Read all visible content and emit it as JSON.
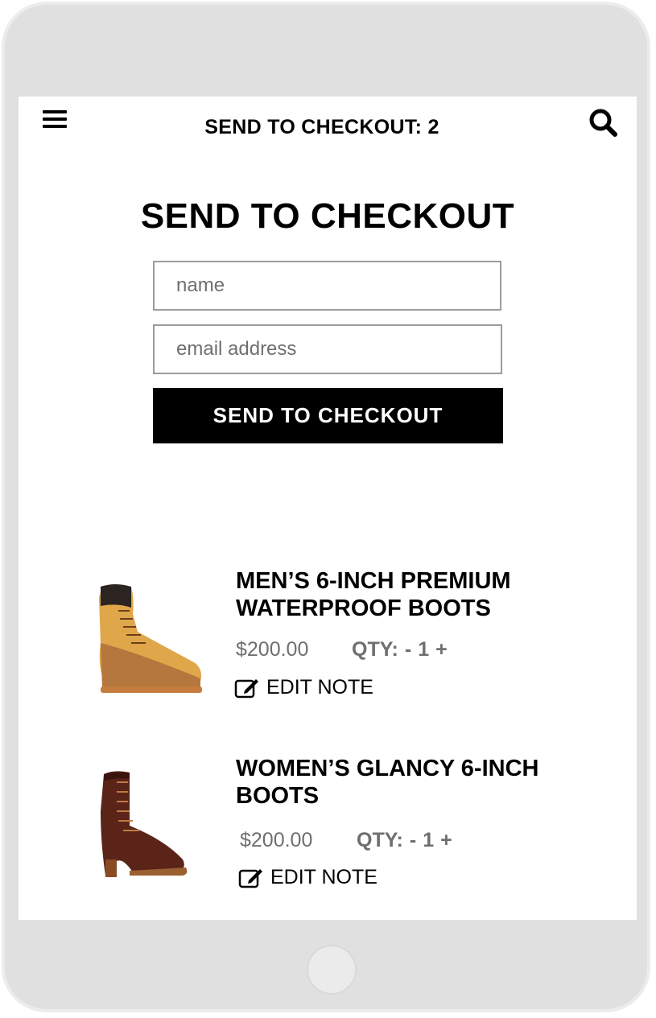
{
  "header": {
    "title": "SEND TO CHECKOUT: 2",
    "menu_icon": "hamburger-menu-icon",
    "search_icon": "search-icon"
  },
  "form": {
    "heading": "SEND TO CHECKOUT",
    "name_placeholder": "name",
    "email_placeholder": "email address",
    "submit_label": "SEND TO CHECKOUT"
  },
  "items": [
    {
      "title": "MEN’S 6-INCH PREMIUM WATERPROOF BOOTS",
      "price": "$200.00",
      "qty_label": "QTY:",
      "qty_minus": "-",
      "qty_value": "1",
      "qty_plus": "+",
      "edit_note_label": "EDIT NOTE",
      "image": "wheat-nubuck-work-boot-image"
    },
    {
      "title": "WOMEN’S GLANCY 6-INCH BOOTS",
      "price": "$200.00",
      "qty_label": "QTY:",
      "qty_minus": "-",
      "qty_value": "1",
      "qty_plus": "+",
      "edit_note_label": "EDIT NOTE",
      "image": "brown-leather-heeled-boot-image"
    }
  ],
  "colors": {
    "frame": "#e0e0e0",
    "button_bg": "#000000",
    "muted_text": "#6f6f6f",
    "input_border": "#9c9c9c"
  }
}
